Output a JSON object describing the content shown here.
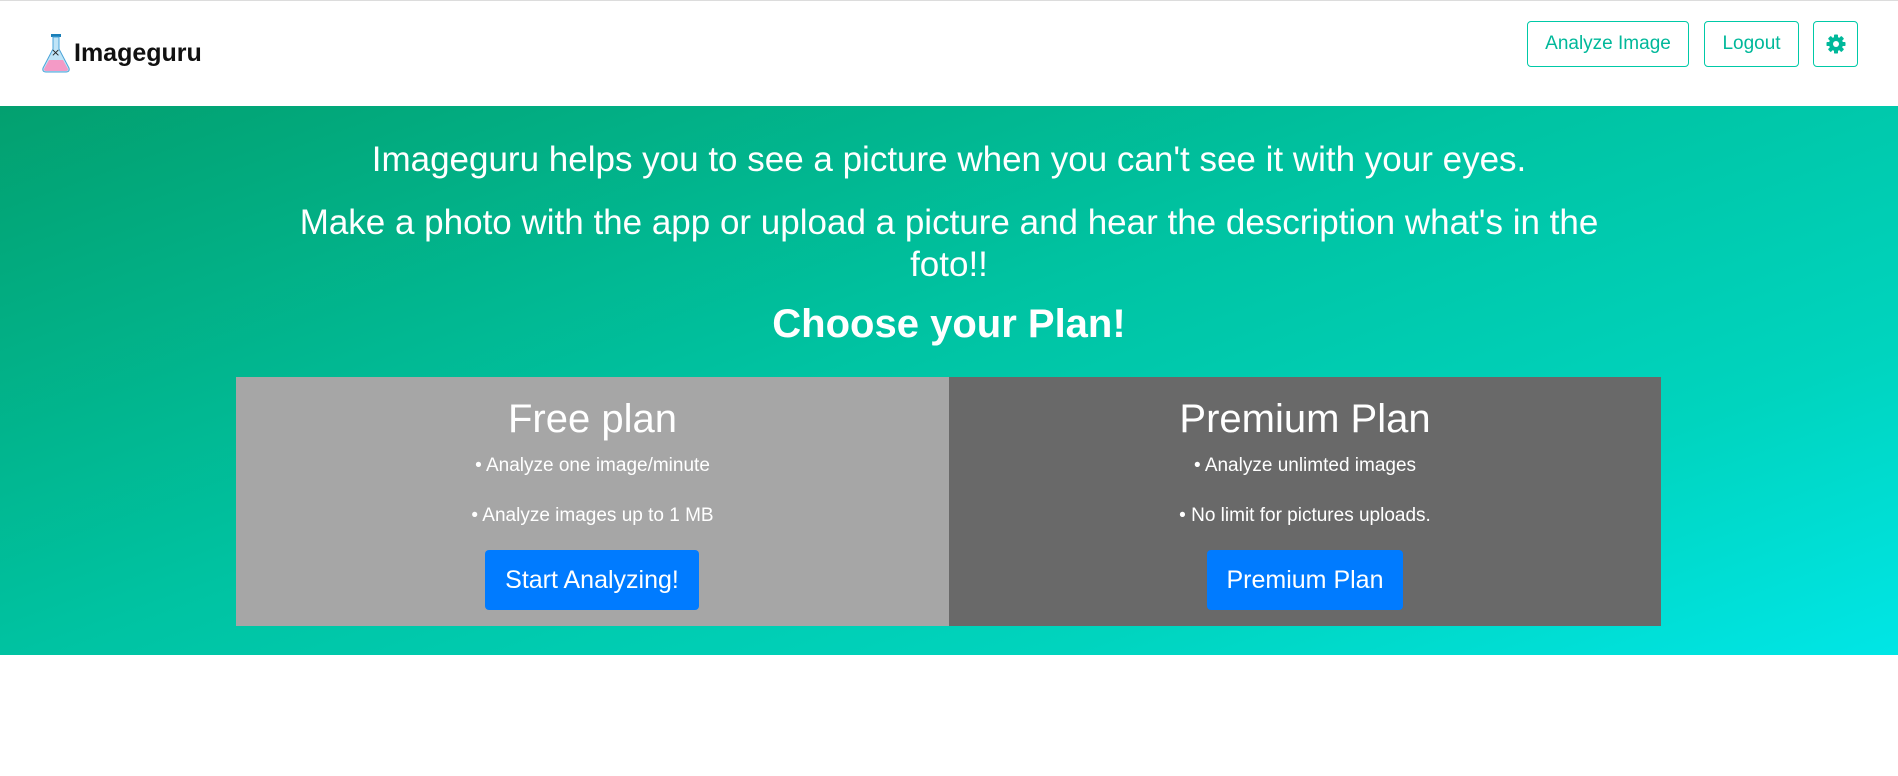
{
  "navbar": {
    "brand": "Imageguru",
    "analyze_label": "Analyze Image",
    "logout_label": "Logout",
    "settings_icon": "gear-icon"
  },
  "hero": {
    "line1": "Imageguru helps you to see a picture when you can't see it with your eyes.",
    "line2": "Make a photo with the app or upload a picture and hear the description what's in the foto!!",
    "heading": "Choose your Plan!"
  },
  "plans": [
    {
      "title": "Free plan",
      "features": [
        "• Analyze one image/minute",
        "• Analyze images up to 1 MB"
      ],
      "button": "Start Analyzing!"
    },
    {
      "title": "Premium Plan",
      "features": [
        "• Analyze unlimted images",
        "• No limit for pictures uploads."
      ],
      "button": "Premium Plan"
    }
  ],
  "colors": {
    "accent": "#00c9a7",
    "primary_button": "#007bff",
    "free_card": "#a6a6a6",
    "premium_card": "#696969"
  }
}
